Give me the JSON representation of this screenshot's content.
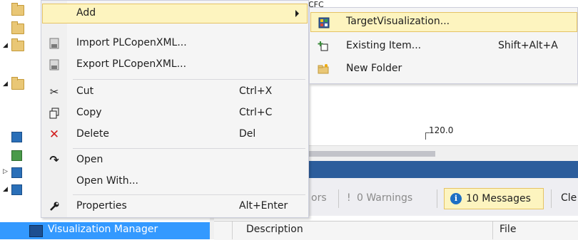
{
  "editor": {
    "tab_label": "CFC",
    "value_label": "120.0"
  },
  "messages_toolbar": {
    "errors_partial": "ors",
    "warnings": "0 Warnings",
    "messages": "10 Messages",
    "clear_partial": "Cle"
  },
  "message_columns": {
    "description": "Description",
    "file": "File"
  },
  "tree": {
    "selected_item": "Visualization Manager"
  },
  "context_menu": {
    "items": [
      {
        "label": "Add",
        "shortcut": "",
        "icon": "none",
        "submenu": true
      },
      {
        "label": "Import PLCopenXML...",
        "shortcut": "",
        "icon": "import-xml-icon"
      },
      {
        "label": "Export PLCopenXML...",
        "shortcut": "",
        "icon": "export-xml-icon"
      },
      {
        "label": "Cut",
        "shortcut": "Ctrl+X",
        "icon": "scissors-icon"
      },
      {
        "label": "Copy",
        "shortcut": "Ctrl+C",
        "icon": "copy-icon"
      },
      {
        "label": "Delete",
        "shortcut": "Del",
        "icon": "delete-x-icon"
      },
      {
        "label": "Open",
        "shortcut": "",
        "icon": "open-arrow-icon"
      },
      {
        "label": "Open With...",
        "shortcut": "",
        "icon": "none"
      },
      {
        "label": "Properties",
        "shortcut": "Alt+Enter",
        "icon": "wrench-icon"
      }
    ]
  },
  "add_submenu": {
    "items": [
      {
        "label": "TargetVisualization...",
        "shortcut": "",
        "icon": "target-visualization-icon"
      },
      {
        "label": "Existing Item...",
        "shortcut": "Shift+Alt+A",
        "icon": "existing-item-icon"
      },
      {
        "label": "New Folder",
        "shortcut": "",
        "icon": "new-folder-icon"
      }
    ]
  },
  "colors": {
    "highlight_bg": "#fdf4bf",
    "highlight_border": "#e5c365",
    "selection_blue": "#3399ff",
    "panel_title_blue": "#2c5d9c"
  }
}
